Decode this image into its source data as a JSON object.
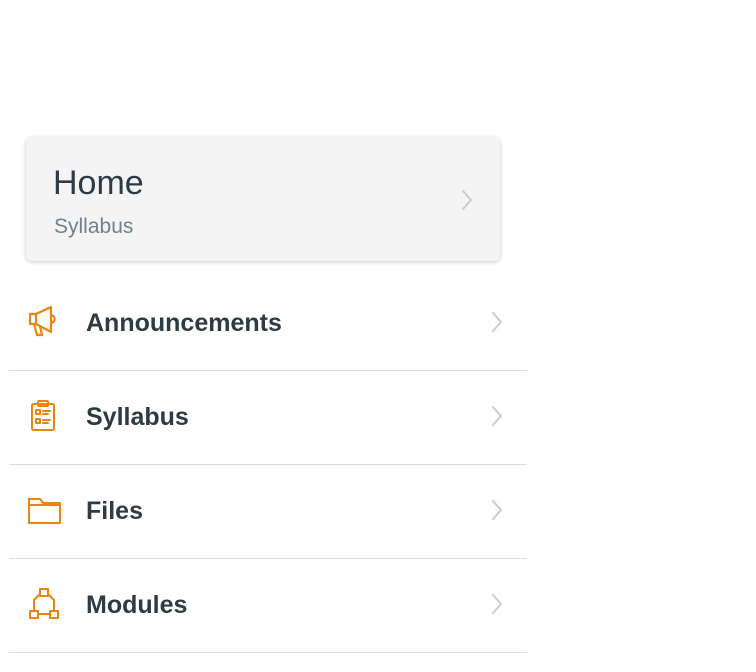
{
  "home": {
    "title": "Home",
    "subtitle": "Syllabus"
  },
  "nav": {
    "items": [
      {
        "label": "Announcements",
        "icon": "megaphone-icon"
      },
      {
        "label": "Syllabus",
        "icon": "syllabus-clipboard-icon"
      },
      {
        "label": "Files",
        "icon": "folder-icon"
      },
      {
        "label": "Modules",
        "icon": "modules-icon"
      }
    ]
  },
  "colors": {
    "icon_accent": "#e8860f",
    "text_primary": "#2d3b45",
    "text_secondary": "#73818c",
    "chevron": "#c7ccd1",
    "divider": "#d9dde0",
    "card_background": "#f4f4f4"
  }
}
